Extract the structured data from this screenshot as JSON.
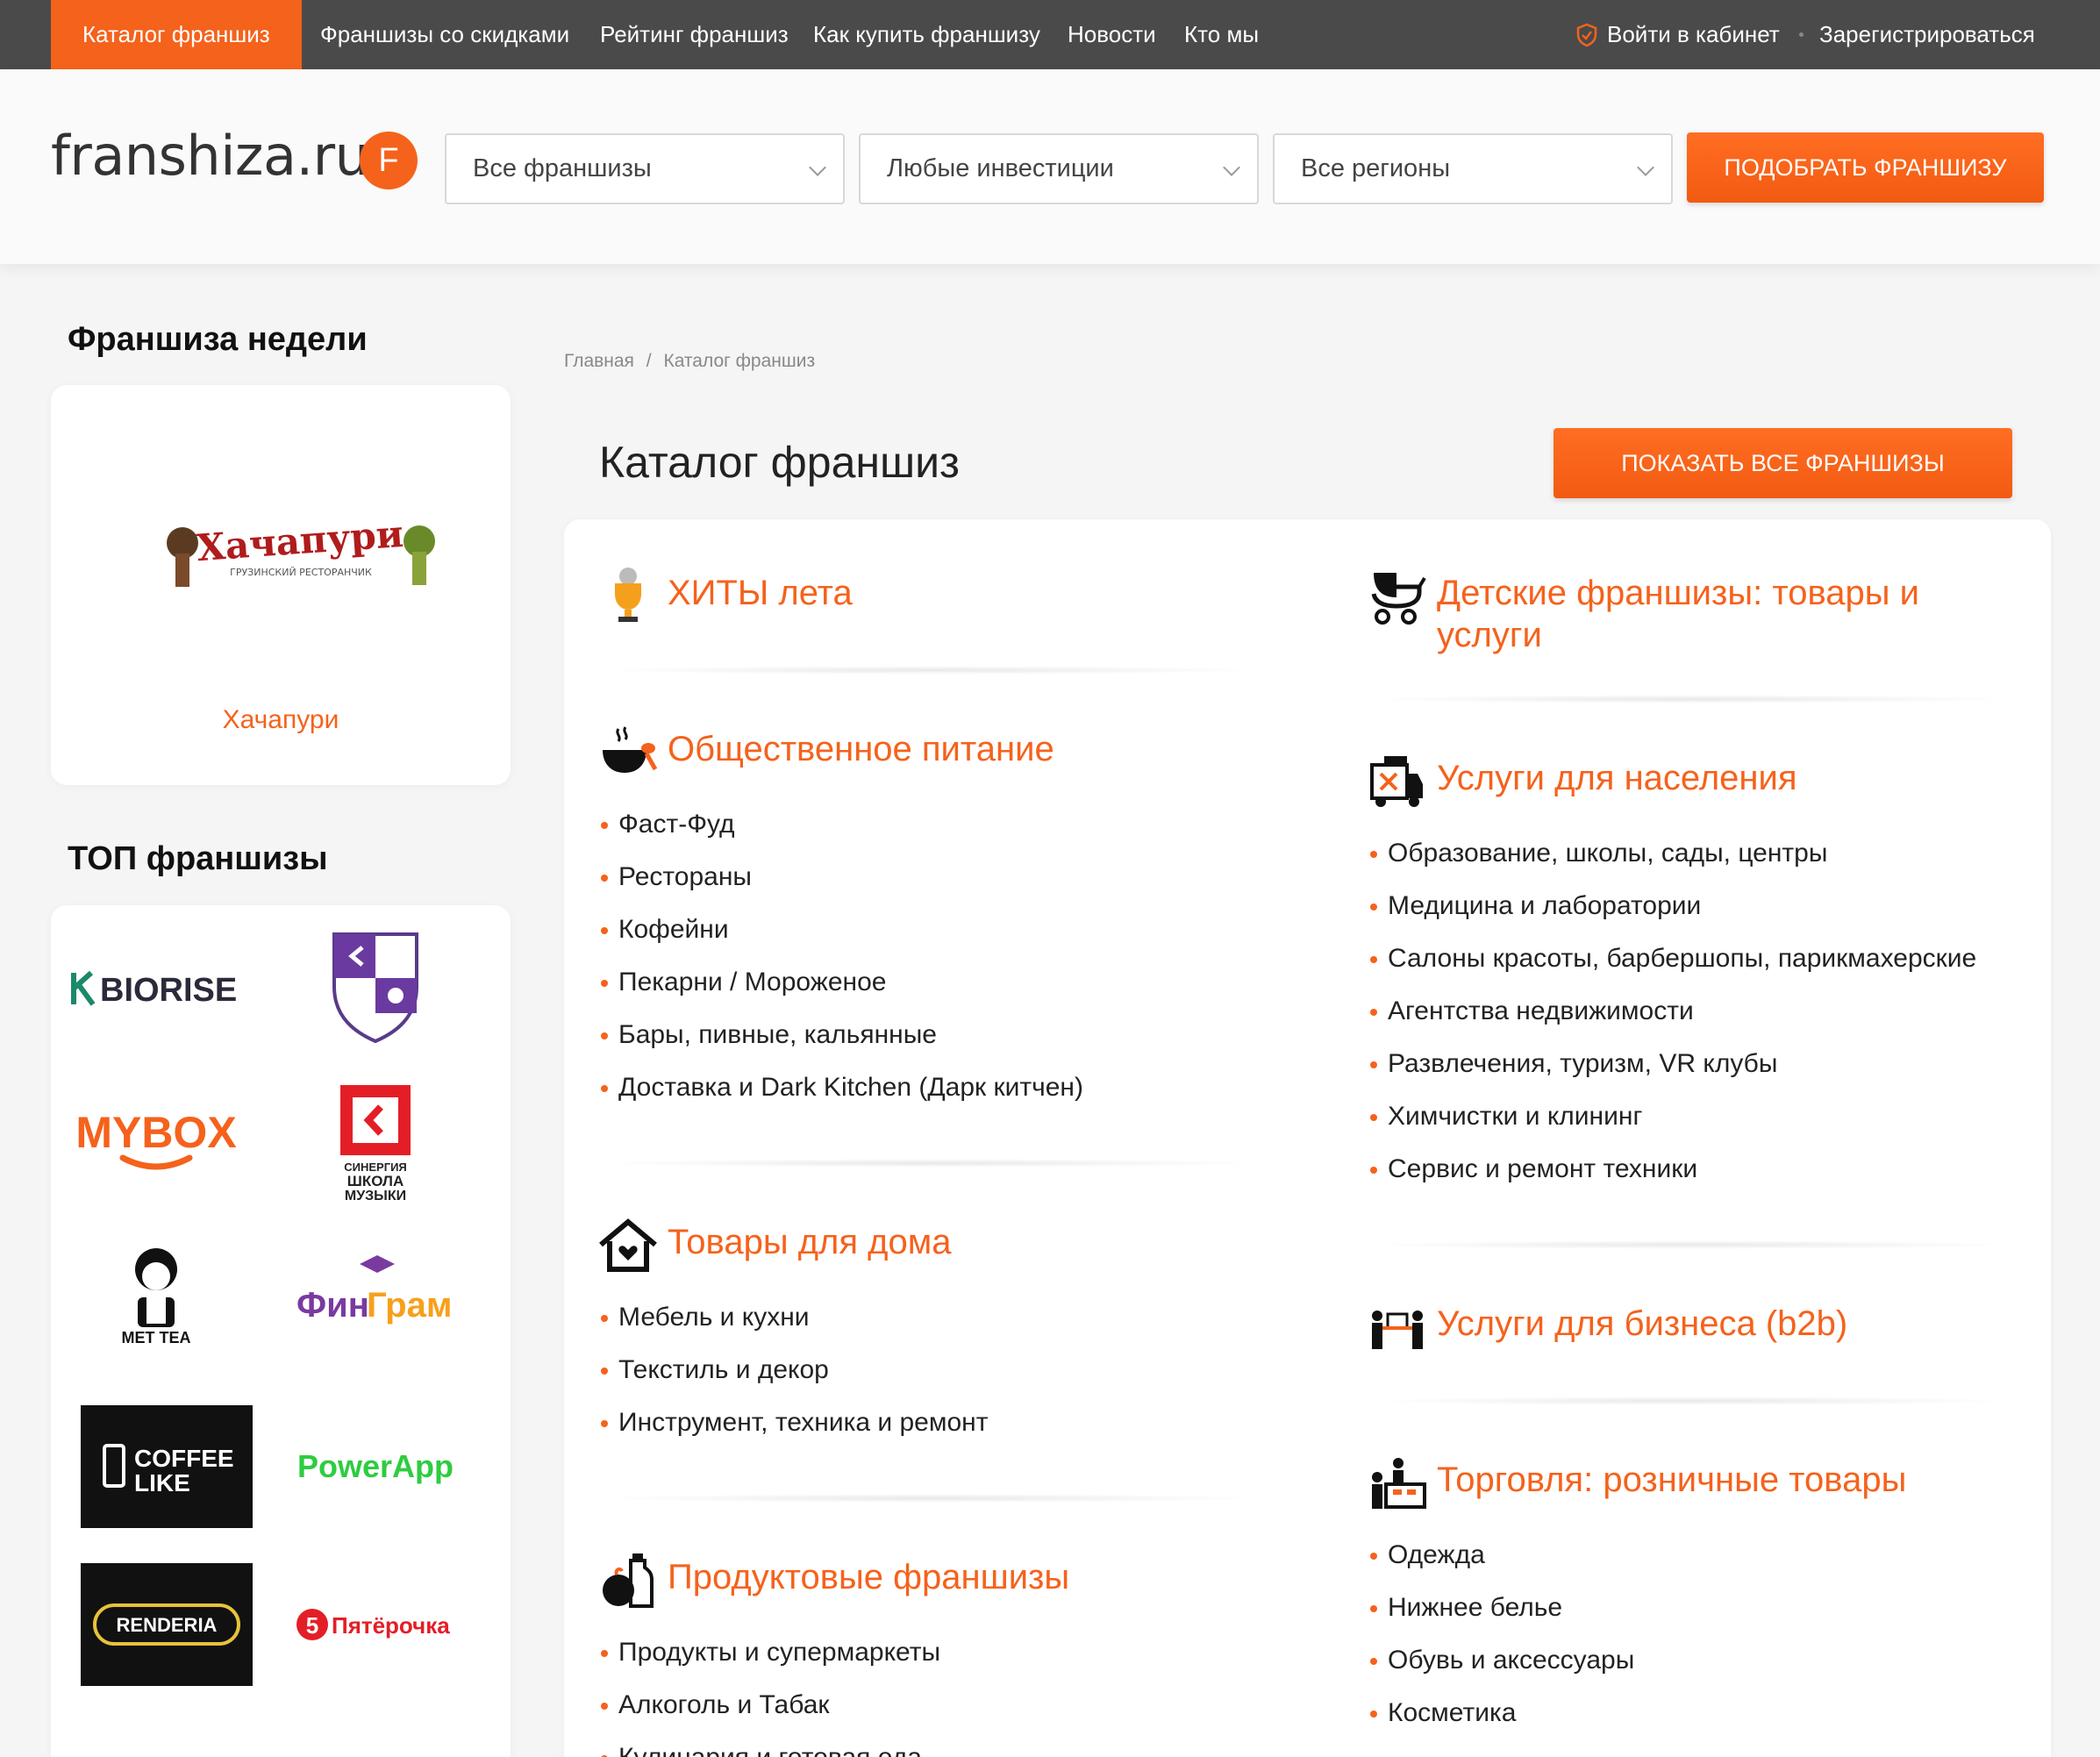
{
  "nav": {
    "catalog": "Каталог франшиз",
    "discounts": "Франшизы со скидками",
    "rating": "Рейтинг франшиз",
    "how_to_buy": "Как купить франшизу",
    "news": "Новости",
    "about": "Кто мы",
    "login": "Войти в кабинет",
    "register": "Зарегистрироваться"
  },
  "header": {
    "logo": "franshiza.ru",
    "logo_letter": "F",
    "filter_type": "Все франшизы",
    "filter_invest": "Любые инвестиции",
    "filter_region": "Все регионы",
    "search_button": "ПОДОБРАТЬ ФРАНШИЗУ"
  },
  "sidebar": {
    "week_title": "Франшиза недели",
    "week_logo_text": "Хачапури",
    "week_logo_sub": "ГРУЗИНСКИЙ РЕСТОРАНЧИК",
    "week_name": "Хачапури",
    "top_title": "ТОП франшизы",
    "top_logos": [
      "BIORISE",
      "MYBOX",
      "СИНЕРГИЯ ШКОЛА МУЗЫКИ",
      "MET TEA",
      "ФинГрам",
      "COFFEE LIKE",
      "PowerApp",
      "RENDERIA",
      "Пятёрочка"
    ]
  },
  "main": {
    "breadcrumb_home": "Главная",
    "breadcrumb_sep": "/",
    "breadcrumb_current": "Каталог франшиз",
    "title": "Каталог франшиз",
    "show_all_button": "ПОКАЗАТЬ ВСЕ ФРАНШИЗЫ"
  },
  "categories_left": [
    {
      "title": "ХИТЫ лета",
      "icon": "trophy-icon",
      "items": []
    },
    {
      "title": "Общественное питание",
      "icon": "food-icon",
      "items": [
        "Фаст-Фуд",
        "Рестораны",
        "Кофейни",
        "Пекарни / Мороженое",
        "Бары, пивные, кальянные",
        "Доставка и Dark Kitchen (Дарк китчен)"
      ]
    },
    {
      "title": "Товары для дома",
      "icon": "home-icon",
      "items": [
        "Мебель и кухни",
        "Текстиль и декор",
        "Инструмент, техника и ремонт"
      ]
    },
    {
      "title": "Продуктовые франшизы",
      "icon": "grocery-icon",
      "items": [
        "Продукты и супермаркеты",
        "Алкоголь и Табак",
        "Кулинария и готовая еда"
      ]
    }
  ],
  "categories_right": [
    {
      "title": "Детские франшизы: товары и услуги",
      "icon": "stroller-icon",
      "items": []
    },
    {
      "title": "Услуги для населения",
      "icon": "services-icon",
      "items": [
        "Образование, школы, сады, центры",
        "Медицина и лаборатории",
        "Салоны красоты, барбершопы, парикмахерские",
        "Агентства недвижимости",
        "Развлечения, туризм, VR клубы",
        "Химчистки и клининг",
        "Сервис и ремонт техники"
      ]
    },
    {
      "title": "Услуги для бизнеса (b2b)",
      "icon": "business-icon",
      "items": []
    },
    {
      "title": "Торговля: розничные товары",
      "icon": "retail-icon",
      "items": [
        "Одежда",
        "Нижнее белье",
        "Обувь и аксессуары",
        "Косметика"
      ]
    }
  ],
  "colors": {
    "accent": "#f5621c",
    "nav_bg": "#4a4a4a"
  }
}
